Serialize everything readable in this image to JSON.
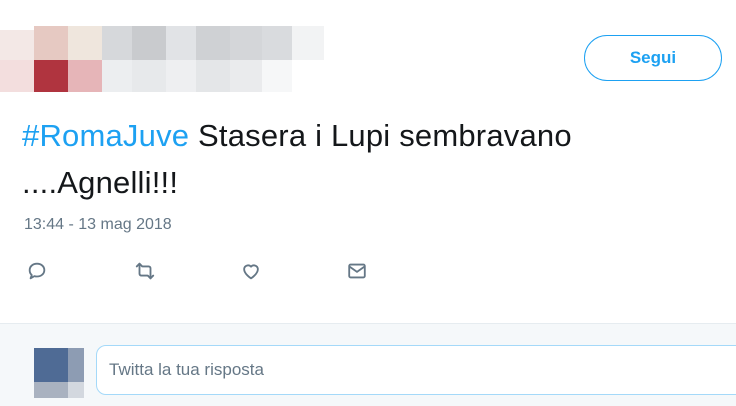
{
  "header": {
    "follow_label": "Segui"
  },
  "tweet": {
    "hashtag": "#RomaJuve",
    "text_line1": " Stasera i Lupi sembravano",
    "text_line2": "....Agnelli!!!",
    "timestamp": "13:44 - 13 mag 2018"
  },
  "actions": {
    "icons": [
      "reply-icon",
      "retweet-icon",
      "like-icon",
      "direct-message-icon"
    ]
  },
  "reply": {
    "placeholder": "Twitta la tua risposta"
  },
  "colors": {
    "accent": "#1da1f2",
    "text": "#14171a",
    "muted": "#657786",
    "reply_bg": "#f5f8fa"
  }
}
